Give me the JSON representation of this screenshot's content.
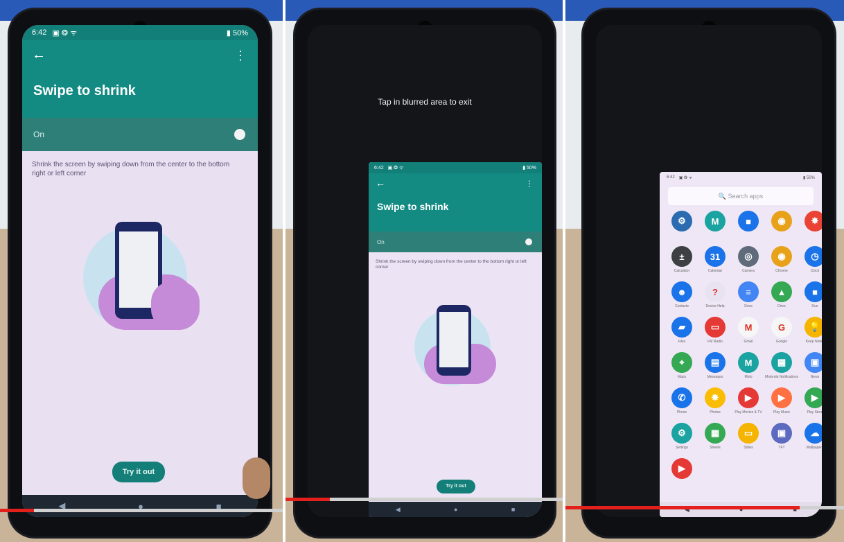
{
  "panel1": {
    "status": {
      "time": "6:42",
      "icons": "▣ ❂ ᯤ",
      "battery": "▮ 50%"
    },
    "back_glyph": "←",
    "menu_glyph": "⋮",
    "title": "Swipe to shrink",
    "toggle_label": "On",
    "description": "Shrink the screen by swiping down from the center to the bottom right or left corner",
    "button_label": "Try it out",
    "nav": {
      "back": "◀",
      "home": "●",
      "recents": "■"
    },
    "progress": 0.12
  },
  "panel2": {
    "hint": "Tap in blurred area to exit",
    "status": {
      "time": "6:42",
      "icons": "▣ ❂ ᯤ",
      "battery": "▮ 50%"
    },
    "back_glyph": "←",
    "menu_glyph": "⋮",
    "title": "Swipe to shrink",
    "toggle_label": "On",
    "description": "Shrink the screen by swiping down from the center to the bottom right or left corner",
    "button_label": "Try it out",
    "nav": {
      "back": "◀",
      "home": "●",
      "recents": "■"
    },
    "progress": 0.16
  },
  "panel3": {
    "status": {
      "time": "6:42",
      "icons": "▣ ❂ ᯤ",
      "battery": "▮ 50%"
    },
    "search_placeholder": "🔍 Search apps",
    "apps": [
      {
        "label": "",
        "color": "#2b6cb0",
        "glyph": "⚙"
      },
      {
        "label": "",
        "color": "#1aa3a0",
        "glyph": "M"
      },
      {
        "label": "",
        "color": "#1a73e8",
        "glyph": "■"
      },
      {
        "label": "",
        "color": "#e8a21a",
        "glyph": "◉"
      },
      {
        "label": "",
        "color": "#ea4335",
        "glyph": "✸"
      },
      {
        "label": "Calculator",
        "color": "#3c4043",
        "glyph": "±"
      },
      {
        "label": "Calendar",
        "color": "#1a73e8",
        "glyph": "31"
      },
      {
        "label": "Camera",
        "color": "#5f6b7a",
        "glyph": "◎"
      },
      {
        "label": "Chrome",
        "color": "#e8a21a",
        "glyph": "◉"
      },
      {
        "label": "Clock",
        "color": "#1a73e8",
        "glyph": "◷"
      },
      {
        "label": "Contacts",
        "color": "#1a73e8",
        "glyph": "☻"
      },
      {
        "label": "Device Help",
        "color": "#e9e3f1",
        "glyph": "?"
      },
      {
        "label": "Docs",
        "color": "#4285f4",
        "glyph": "≡"
      },
      {
        "label": "Drive",
        "color": "#34a853",
        "glyph": "▲"
      },
      {
        "label": "Duo",
        "color": "#1a73e8",
        "glyph": "■"
      },
      {
        "label": "Files",
        "color": "#1a73e8",
        "glyph": "▰"
      },
      {
        "label": "FM Radio",
        "color": "#e53935",
        "glyph": "▭"
      },
      {
        "label": "Gmail",
        "color": "#f6f6f6",
        "glyph": "M"
      },
      {
        "label": "Google",
        "color": "#f6f6f6",
        "glyph": "G"
      },
      {
        "label": "Keep Notes",
        "color": "#f4b400",
        "glyph": "💡"
      },
      {
        "label": "Maps",
        "color": "#34a853",
        "glyph": "⌖"
      },
      {
        "label": "Messages",
        "color": "#1a73e8",
        "glyph": "▤"
      },
      {
        "label": "Moto",
        "color": "#1aa3a0",
        "glyph": "M"
      },
      {
        "label": "Motorola Notifications",
        "color": "#1aa3a0",
        "glyph": "▦"
      },
      {
        "label": "News",
        "color": "#4285f4",
        "glyph": "▣"
      },
      {
        "label": "Phone",
        "color": "#1a73e8",
        "glyph": "✆"
      },
      {
        "label": "Photos",
        "color": "#fbbc04",
        "glyph": "✸"
      },
      {
        "label": "Play Movies & TV",
        "color": "#e53935",
        "glyph": "▶"
      },
      {
        "label": "Play Music",
        "color": "#ff7043",
        "glyph": "▶"
      },
      {
        "label": "Play Store",
        "color": "#34a853",
        "glyph": "▶"
      },
      {
        "label": "Settings",
        "color": "#1aa3a0",
        "glyph": "⚙"
      },
      {
        "label": "Sheets",
        "color": "#34a853",
        "glyph": "▦"
      },
      {
        "label": "Slides",
        "color": "#f4b400",
        "glyph": "▭"
      },
      {
        "label": "TFT",
        "color": "#5c6bc0",
        "glyph": "▣"
      },
      {
        "label": "Wallpapers",
        "color": "#1a73e8",
        "glyph": "☁"
      },
      {
        "label": "",
        "color": "#e53935",
        "glyph": "▶"
      }
    ],
    "nav": {
      "back": "◀",
      "home": "●",
      "recents": "■"
    },
    "progress": 0.84
  }
}
